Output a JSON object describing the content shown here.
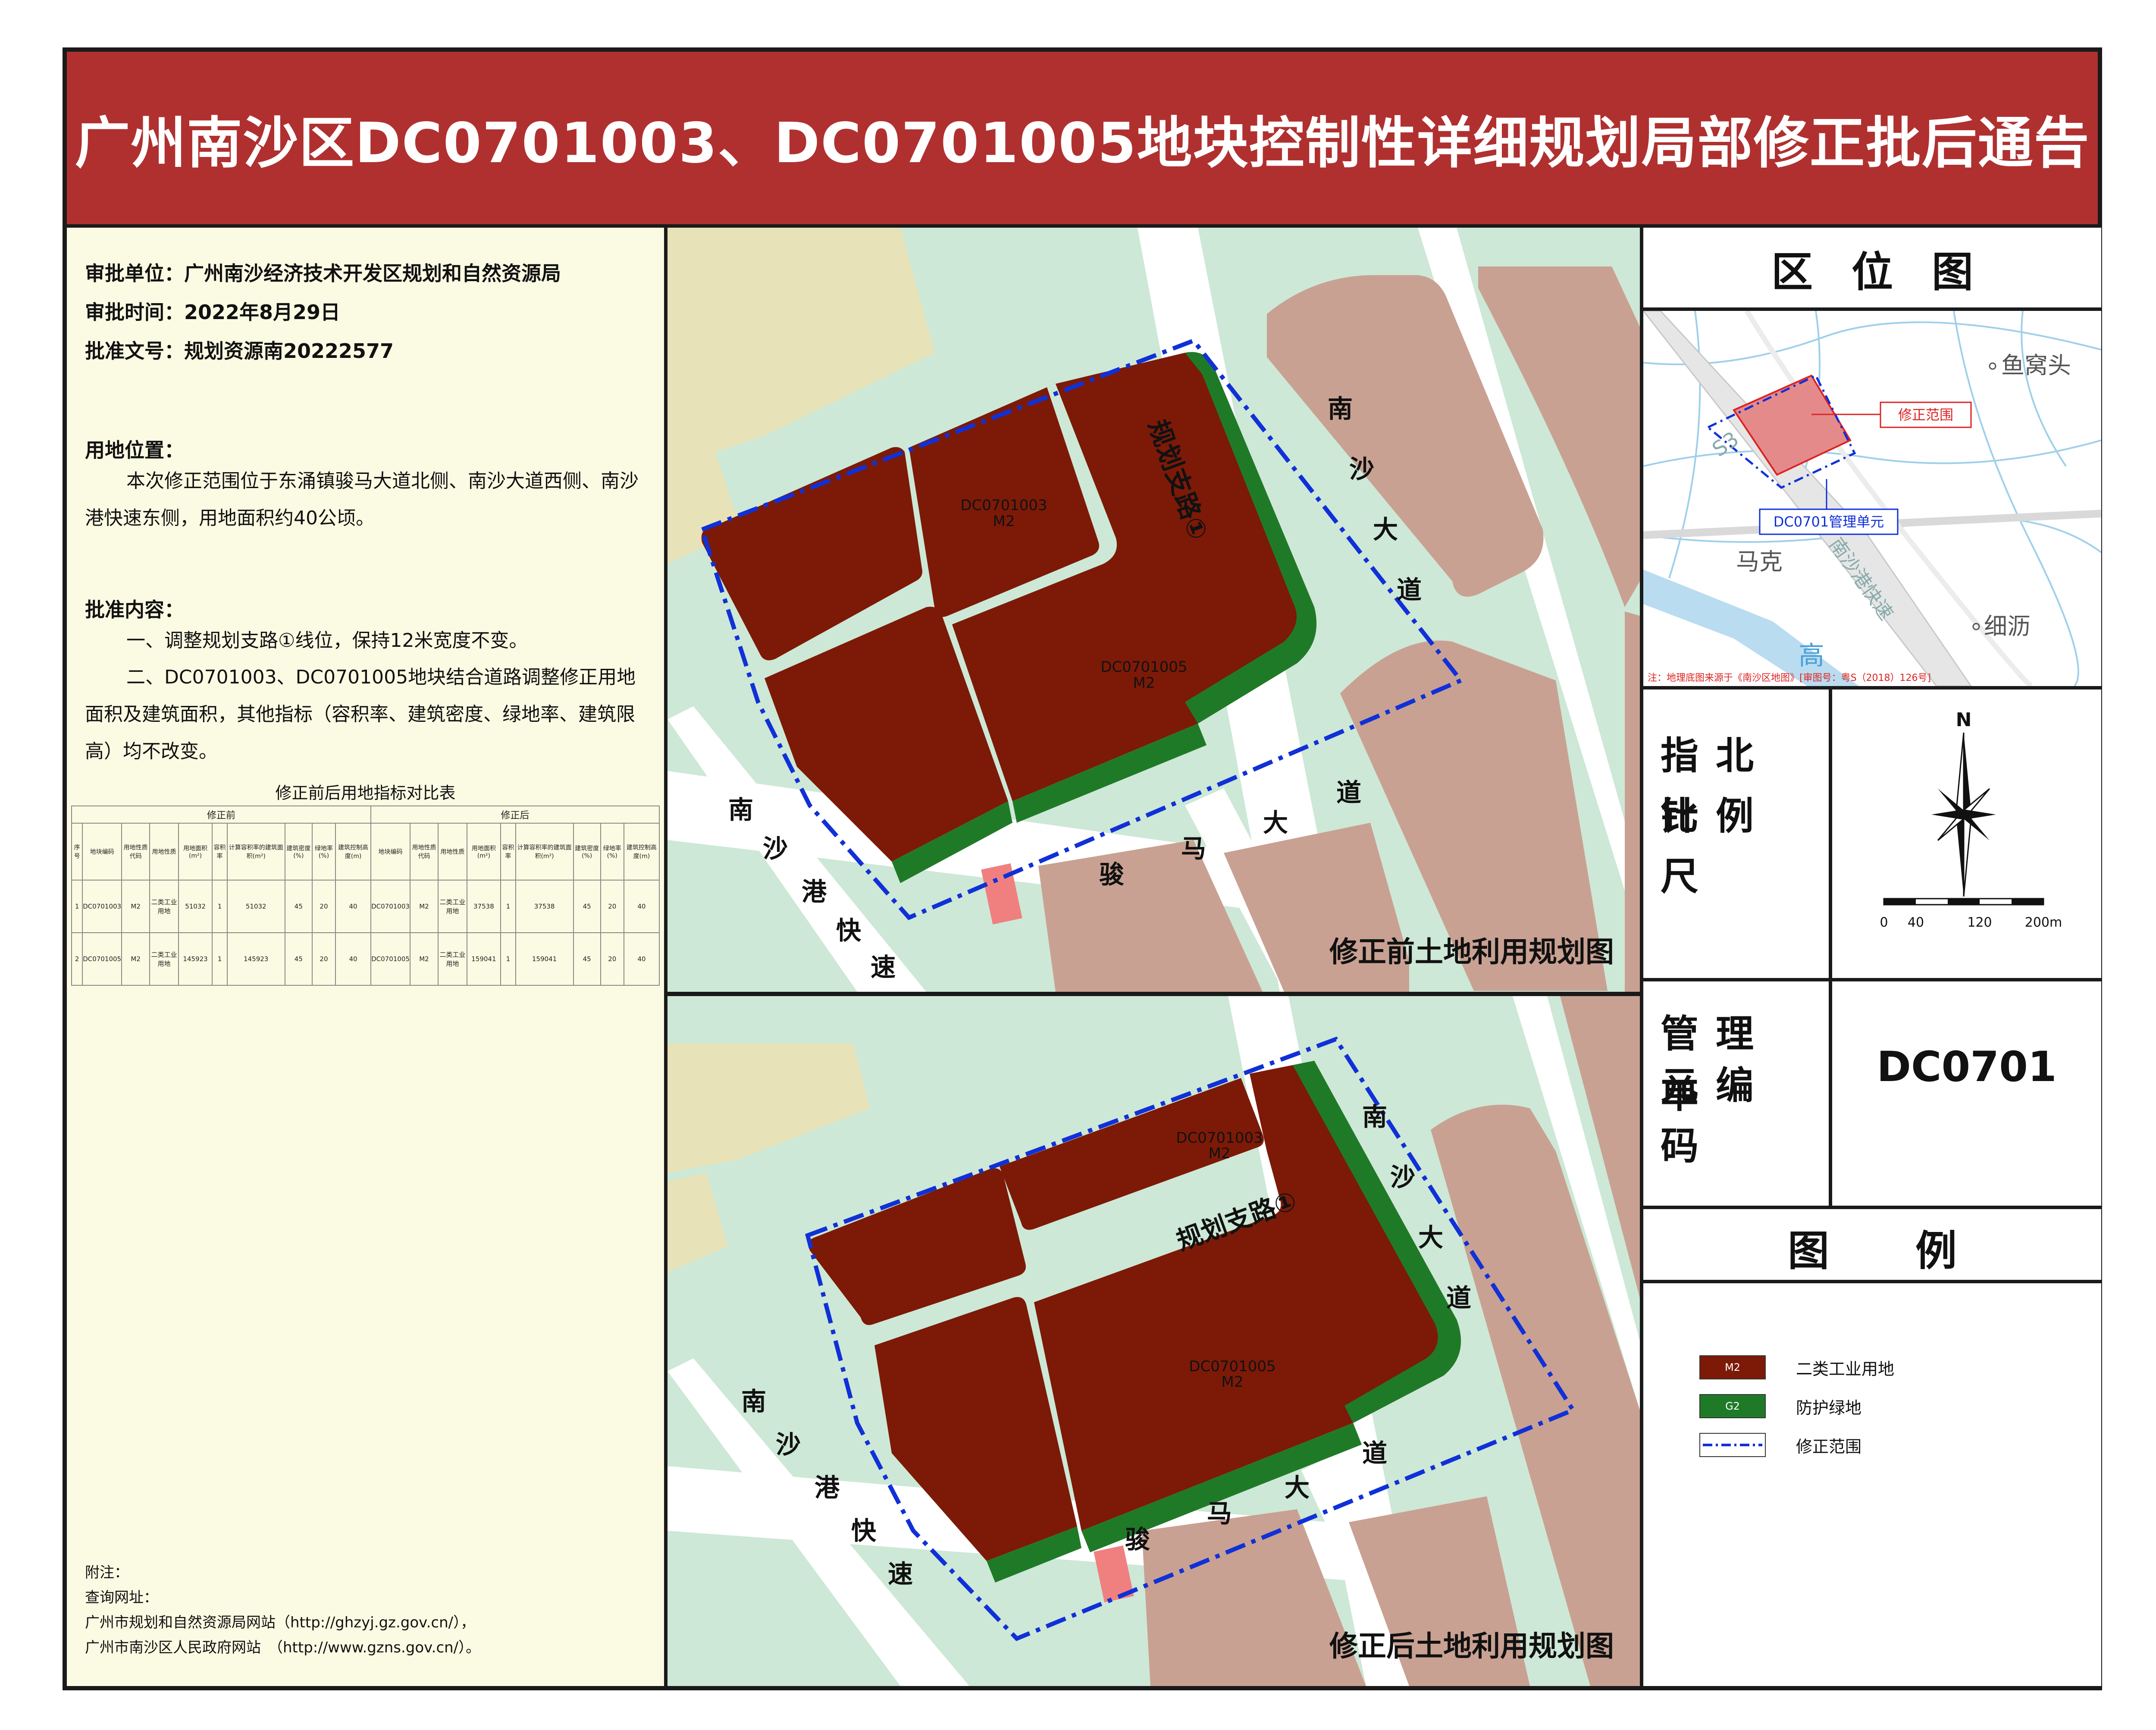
{
  "title": "广州南沙区DC0701003、DC0701005地块控制性详细规划局部修正批后通告",
  "info": {
    "approver": "审批单位：广州南沙经济技术开发区规划和自然资源局",
    "date": "审批时间：2022年8月29日",
    "doc_no": "批准文号：规划资源南20222577",
    "location_heading": "用地位置：",
    "location_text": "本次修正范围位于东涌镇骏马大道北侧、南沙大道西侧、南沙港快速东侧，用地面积约40公顷。",
    "content_heading": "批准内容：",
    "content_1": "一、调整规划支路①线位，保持12米宽度不变。",
    "content_2": "二、DC0701003、DC0701005地块结合道路调整修正用地面积及建筑面积，其他指标（容积率、建筑密度、绿地率、建筑限高）均不改变。"
  },
  "table": {
    "title": "修正前后用地指标对比表",
    "group_before": "修正前",
    "group_after": "修正后",
    "headers": [
      "序号",
      "地块编码",
      "用地性质代码",
      "用地性质",
      "用地面积(m²)",
      "容积率",
      "计算容积率的建筑面积(m²)",
      "建筑密度(%)",
      "绿地率(%)",
      "建筑控制高度(m)",
      "地块编码",
      "用地性质代码",
      "用地性质",
      "用地面积(m²)",
      "容积率",
      "计算容积率的建筑面积(m²)",
      "建筑密度(%)",
      "绿地率(%)",
      "建筑控制高度(m)"
    ],
    "rows": [
      [
        "1",
        "DC0701003",
        "M2",
        "二类工业用地",
        "51032",
        "1",
        "51032",
        "45",
        "20",
        "40",
        "DC0701003",
        "M2",
        "二类工业用地",
        "37538",
        "1",
        "37538",
        "45",
        "20",
        "40"
      ],
      [
        "2",
        "DC0701005",
        "M2",
        "二类工业用地",
        "145923",
        "1",
        "145923",
        "45",
        "20",
        "40",
        "DC0701005",
        "M2",
        "二类工业用地",
        "159041",
        "1",
        "159041",
        "45",
        "20",
        "40"
      ]
    ]
  },
  "notes": {
    "heading": "附注：",
    "line1": "查询网址：",
    "line2": "广州市规划和自然资源局网站（http://ghzyj.gz.gov.cn/），",
    "line3": "广州市南沙区人民政府网站　（http://www.gzns.gov.cn/）。"
  },
  "map_before": {
    "label": "修正前土地利用规划图",
    "parcel_a_code": "DC0701003",
    "parcel_a_use": "M2",
    "parcel_b_code": "DC0701005",
    "parcel_b_use": "M2",
    "road_branch": "规划支路①",
    "road_nansha_chars": [
      "南",
      "沙",
      "大",
      "道"
    ],
    "road_junma_chars": [
      "骏",
      "马",
      "大",
      "道"
    ],
    "road_expressway_chars": [
      "南",
      "沙",
      "港",
      "快",
      "速"
    ]
  },
  "map_after": {
    "label": "修正后土地利用规划图",
    "parcel_a_code": "DC0701003",
    "parcel_a_use": "M2",
    "parcel_b_code": "DC0701005",
    "parcel_b_use": "M2",
    "road_branch": "规划支路①",
    "road_nansha_chars": [
      "南",
      "沙",
      "大",
      "道"
    ],
    "road_junma_chars": [
      "骏",
      "马",
      "大",
      "道"
    ],
    "road_expressway_chars": [
      "南",
      "沙",
      "港",
      "快",
      "速"
    ]
  },
  "location_map": {
    "heading": "区位图",
    "label_revision": "修正范围",
    "label_unit": "DC0701管理单元",
    "place_yuwotou": "鱼窝头",
    "place_make": "马克",
    "place_xili": "细沥",
    "place_gao": "高",
    "road_s3": "S3",
    "road_nansha_express": "南沙港快速",
    "source_note": "注：地理底图来源于《南沙区地图》[审图号：粤S（2018）126号]"
  },
  "compass": {
    "title_line1": "指北针",
    "title_line2": "比例尺",
    "north": "N",
    "scale_labels": [
      "0",
      "40",
      "120",
      "200m"
    ]
  },
  "unit_code": {
    "title_line1": "管理单",
    "title_line2": "元编码",
    "value": "DC0701"
  },
  "legend": {
    "heading": "图例",
    "items": [
      {
        "swatch": "M2",
        "label": "二类工业用地",
        "color": "#7c1a07"
      },
      {
        "swatch": "G2",
        "label": "防护绿地",
        "color": "#1f7a28"
      },
      {
        "swatch": "",
        "label": "修正范围",
        "color": "#1030d8"
      }
    ]
  },
  "colors": {
    "title_bar": "#b03030",
    "industrial": "#7c1a07",
    "green_buffer": "#1f7a28",
    "background_green": "#cde8d6",
    "other_land": "#c9a192",
    "agri": "#e7e2b8",
    "boundary": "#1030d8",
    "left_panel": "#fbfbe3"
  }
}
